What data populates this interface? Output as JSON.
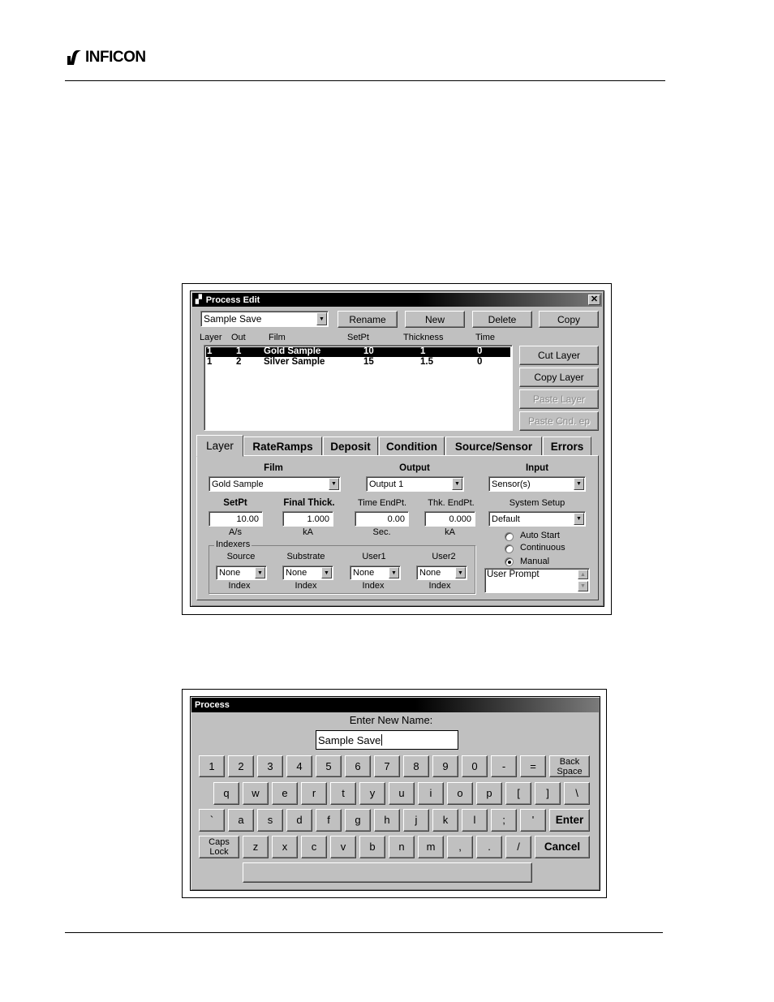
{
  "logo": {
    "text": "INFICON"
  },
  "process_edit": {
    "title": "Process Edit",
    "close_label": "✕",
    "process_select": "Sample Save",
    "buttons": {
      "rename": "Rename",
      "new": "New",
      "delete": "Delete",
      "copy": "Copy"
    },
    "columns": [
      "Layer",
      "Out",
      "Film",
      "SetPt",
      "Thickness",
      "Time"
    ],
    "rows": [
      {
        "layer": "1",
        "out": "1",
        "film": "Gold Sample",
        "setpt": "10",
        "thickness": "1",
        "time": "0"
      },
      {
        "layer": "1",
        "out": "2",
        "film": "Silver Sample",
        "setpt": "15",
        "thickness": "1.5",
        "time": "0"
      }
    ],
    "side_buttons": {
      "cut_layer": "Cut Layer",
      "copy_layer": "Copy Layer",
      "paste_layer": "Paste Layer",
      "paste_cond": "Paste Cnd. ep"
    },
    "tabs": [
      "Layer",
      "RateRamps",
      "Deposit",
      "Condition",
      "Source/Sensor",
      "Errors"
    ],
    "layer_tab": {
      "film_label": "Film",
      "film_value": "Gold Sample",
      "output_label": "Output",
      "output_value": "Output 1",
      "input_label": "Input",
      "input_value": "Sensor(s)",
      "setpt_label": "SetPt",
      "setpt_value": "10.00",
      "setpt_unit": "A/s",
      "final_thick_label": "Final Thick.",
      "final_thick_value": "1.000",
      "final_thick_unit": "kA",
      "time_endpt_label": "Time EndPt.",
      "time_endpt_value": "0.00",
      "time_endpt_unit": "Sec.",
      "thk_endpt_label": "Thk. EndPt.",
      "thk_endpt_value": "0.000",
      "thk_endpt_unit": "kA",
      "system_setup_label": "System Setup",
      "system_setup_value": "Default",
      "radio_auto": "Auto Start",
      "radio_continuous": "Continuous",
      "radio_manual": "Manual",
      "indexers_label": "Indexers",
      "source_label": "Source",
      "substrate_label": "Substrate",
      "user1_label": "User1",
      "user2_label": "User2",
      "none": "None",
      "index_label": "Index",
      "user_prompt": "User Prompt"
    }
  },
  "process_dialog": {
    "title": "Process",
    "prompt": "Enter New Name:",
    "name_value": "Sample Save",
    "keys": {
      "row1": [
        "1",
        "2",
        "3",
        "4",
        "5",
        "6",
        "7",
        "8",
        "9",
        "0",
        "-",
        "="
      ],
      "back_line1": "Back",
      "back_line2": "Space",
      "row2": [
        "q",
        "w",
        "e",
        "r",
        "t",
        "y",
        "u",
        "i",
        "o",
        "p",
        "[",
        "]",
        "\\"
      ],
      "row3": [
        "`",
        "a",
        "s",
        "d",
        "f",
        "g",
        "h",
        "j",
        "k",
        "l",
        ";",
        "'"
      ],
      "enter": "Enter",
      "caps_line1": "Caps",
      "caps_line2": "Lock",
      "row4": [
        "z",
        "x",
        "c",
        "v",
        "b",
        "n",
        "m",
        ",",
        ".",
        "/"
      ],
      "cancel": "Cancel"
    }
  }
}
